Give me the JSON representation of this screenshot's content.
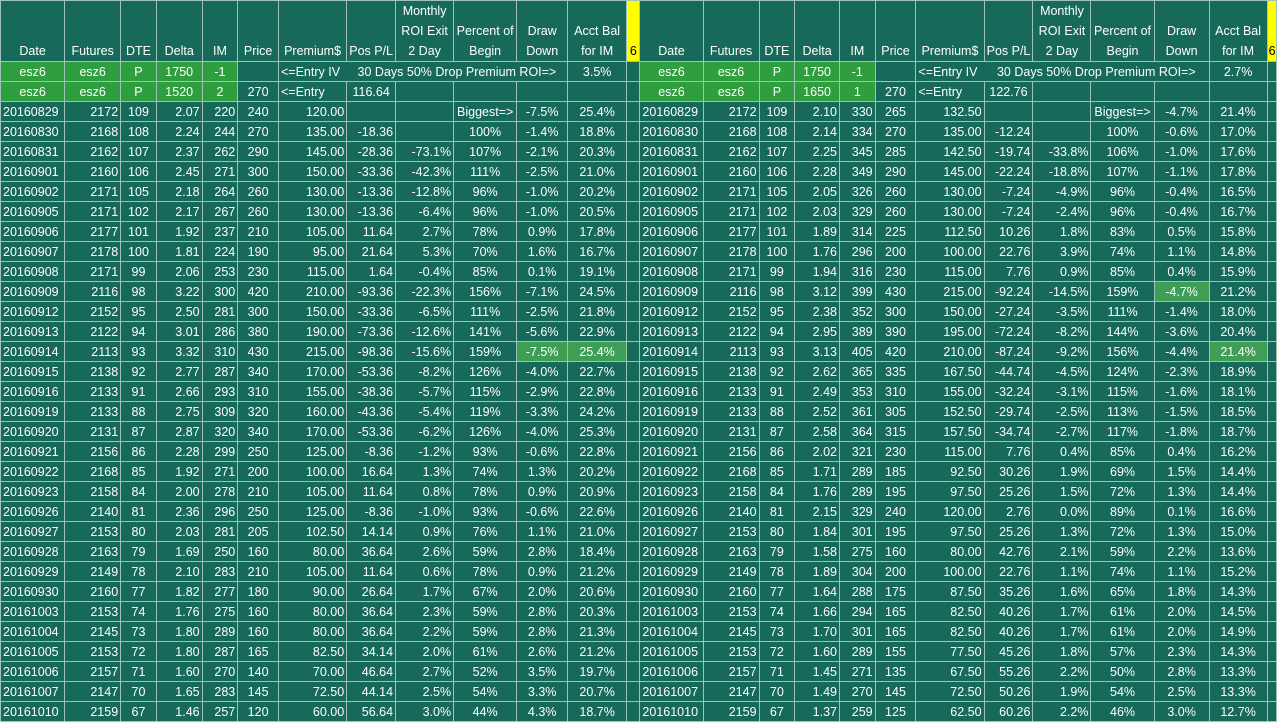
{
  "headers_left": [
    "Date",
    "Futures",
    "DTE",
    "Delta",
    "IM",
    "Price",
    "Premium$",
    "Pos P/L",
    "Monthly ROI Exit 2 Day",
    "Percent of Begin",
    "Draw Down",
    "Acct Bal for IM",
    "6"
  ],
  "headers_right": [
    "Date",
    "Futures",
    "DTE",
    "Delta",
    "IM",
    "Price",
    "Premium$",
    "Pos P/L",
    "Monthly ROI Exit 2 Day",
    "Percent of Begin",
    "Draw Down",
    "Acct Bal for IM",
    "6"
  ],
  "left": {
    "entry1": {
      "date": "esz6",
      "fut": "esz6",
      "type": "P",
      "strike": "1750",
      "qty": "-1",
      "note": "<=Entry IV",
      "note2": "30 Days 50% Drop Premium ROI=>",
      "roi": "3.5%"
    },
    "entry2": {
      "date": "esz6",
      "fut": "esz6",
      "type": "P",
      "strike": "1520",
      "qty": "2",
      "price": "270",
      "note": "<=Entry",
      "value": "116.64"
    },
    "biggest_label": "Biggest=>"
  },
  "right": {
    "entry1": {
      "date": "esz6",
      "fut": "esz6",
      "type": "P",
      "strike": "1750",
      "qty": "-1",
      "note": "<=Entry IV",
      "note2": "30 Days 50% Drop Premium ROI=>",
      "roi": "2.7%"
    },
    "entry2": {
      "date": "esz6",
      "fut": "esz6",
      "type": "P",
      "strike": "1650",
      "qty": "1",
      "price": "270",
      "note": "<=Entry",
      "value": "122.76"
    },
    "biggest_label": "Biggest=>"
  },
  "rows": [
    {
      "l": [
        "20160829",
        "2172",
        "109",
        "2.07",
        "220",
        "240",
        "120.00",
        "",
        "",
        "",
        "-7.5%",
        "25.4%"
      ],
      "r": [
        "20160829",
        "2172",
        "109",
        "2.10",
        "330",
        "265",
        "132.50",
        "",
        "",
        "",
        "-4.7%",
        "21.4%"
      ]
    },
    {
      "l": [
        "20160830",
        "2168",
        "108",
        "2.24",
        "244",
        "270",
        "135.00",
        "-18.36",
        "",
        "100%",
        "-1.4%",
        "18.8%"
      ],
      "r": [
        "20160830",
        "2168",
        "108",
        "2.14",
        "334",
        "270",
        "135.00",
        "-12.24",
        "",
        "100%",
        "-0.6%",
        "17.0%"
      ]
    },
    {
      "l": [
        "20160831",
        "2162",
        "107",
        "2.37",
        "262",
        "290",
        "145.00",
        "-28.36",
        "-73.1%",
        "107%",
        "-2.1%",
        "20.3%"
      ],
      "r": [
        "20160831",
        "2162",
        "107",
        "2.25",
        "345",
        "285",
        "142.50",
        "-19.74",
        "-33.8%",
        "106%",
        "-1.0%",
        "17.6%"
      ]
    },
    {
      "l": [
        "20160901",
        "2160",
        "106",
        "2.45",
        "271",
        "300",
        "150.00",
        "-33.36",
        "-42.3%",
        "111%",
        "-2.5%",
        "21.0%"
      ],
      "r": [
        "20160901",
        "2160",
        "106",
        "2.28",
        "349",
        "290",
        "145.00",
        "-22.24",
        "-18.8%",
        "107%",
        "-1.1%",
        "17.8%"
      ]
    },
    {
      "l": [
        "20160902",
        "2171",
        "105",
        "2.18",
        "264",
        "260",
        "130.00",
        "-13.36",
        "-12.8%",
        "96%",
        "-1.0%",
        "20.2%"
      ],
      "r": [
        "20160902",
        "2171",
        "105",
        "2.05",
        "326",
        "260",
        "130.00",
        "-7.24",
        "-4.9%",
        "96%",
        "-0.4%",
        "16.5%"
      ]
    },
    {
      "l": [
        "20160905",
        "2171",
        "102",
        "2.17",
        "267",
        "260",
        "130.00",
        "-13.36",
        "-6.4%",
        "96%",
        "-1.0%",
        "20.5%"
      ],
      "r": [
        "20160905",
        "2171",
        "102",
        "2.03",
        "329",
        "260",
        "130.00",
        "-7.24",
        "-2.4%",
        "96%",
        "-0.4%",
        "16.7%"
      ]
    },
    {
      "l": [
        "20160906",
        "2177",
        "101",
        "1.92",
        "237",
        "210",
        "105.00",
        "11.64",
        "2.7%",
        "78%",
        "0.9%",
        "17.8%"
      ],
      "r": [
        "20160906",
        "2177",
        "101",
        "1.89",
        "314",
        "225",
        "112.50",
        "10.26",
        "1.8%",
        "83%",
        "0.5%",
        "15.8%"
      ]
    },
    {
      "l": [
        "20160907",
        "2178",
        "100",
        "1.81",
        "224",
        "190",
        "95.00",
        "21.64",
        "5.3%",
        "70%",
        "1.6%",
        "16.7%"
      ],
      "r": [
        "20160907",
        "2178",
        "100",
        "1.76",
        "296",
        "200",
        "100.00",
        "22.76",
        "3.9%",
        "74%",
        "1.1%",
        "14.8%"
      ]
    },
    {
      "l": [
        "20160908",
        "2171",
        "99",
        "2.06",
        "253",
        "230",
        "115.00",
        "1.64",
        "-0.4%",
        "85%",
        "0.1%",
        "19.1%"
      ],
      "r": [
        "20160908",
        "2171",
        "99",
        "1.94",
        "316",
        "230",
        "115.00",
        "7.76",
        "0.9%",
        "85%",
        "0.4%",
        "15.9%"
      ]
    },
    {
      "l": [
        "20160909",
        "2116",
        "98",
        "3.22",
        "300",
        "420",
        "210.00",
        "-93.36",
        "-22.3%",
        "156%",
        "-7.1%",
        "24.5%"
      ],
      "r": [
        "20160909",
        "2116",
        "98",
        "3.12",
        "399",
        "430",
        "215.00",
        "-92.24",
        "-14.5%",
        "159%",
        "-4.7%",
        "21.2%"
      ]
    },
    {
      "l": [
        "20160912",
        "2152",
        "95",
        "2.50",
        "281",
        "300",
        "150.00",
        "-33.36",
        "-6.5%",
        "111%",
        "-2.5%",
        "21.8%"
      ],
      "r": [
        "20160912",
        "2152",
        "95",
        "2.38",
        "352",
        "300",
        "150.00",
        "-27.24",
        "-3.5%",
        "111%",
        "-1.4%",
        "18.0%"
      ]
    },
    {
      "l": [
        "20160913",
        "2122",
        "94",
        "3.01",
        "286",
        "380",
        "190.00",
        "-73.36",
        "-12.6%",
        "141%",
        "-5.6%",
        "22.9%"
      ],
      "r": [
        "20160913",
        "2122",
        "94",
        "2.95",
        "389",
        "390",
        "195.00",
        "-72.24",
        "-8.2%",
        "144%",
        "-3.6%",
        "20.4%"
      ]
    },
    {
      "l": [
        "20160914",
        "2113",
        "93",
        "3.32",
        "310",
        "430",
        "215.00",
        "-98.36",
        "-15.6%",
        "159%",
        "-7.5%",
        "25.4%"
      ],
      "r": [
        "20160914",
        "2113",
        "93",
        "3.13",
        "405",
        "420",
        "210.00",
        "-87.24",
        "-9.2%",
        "156%",
        "-4.4%",
        "21.4%"
      ]
    },
    {
      "l": [
        "20160915",
        "2138",
        "92",
        "2.77",
        "287",
        "340",
        "170.00",
        "-53.36",
        "-8.2%",
        "126%",
        "-4.0%",
        "22.7%"
      ],
      "r": [
        "20160915",
        "2138",
        "92",
        "2.62",
        "365",
        "335",
        "167.50",
        "-44.74",
        "-4.5%",
        "124%",
        "-2.3%",
        "18.9%"
      ]
    },
    {
      "l": [
        "20160916",
        "2133",
        "91",
        "2.66",
        "293",
        "310",
        "155.00",
        "-38.36",
        "-5.7%",
        "115%",
        "-2.9%",
        "22.8%"
      ],
      "r": [
        "20160916",
        "2133",
        "91",
        "2.49",
        "353",
        "310",
        "155.00",
        "-32.24",
        "-3.1%",
        "115%",
        "-1.6%",
        "18.1%"
      ]
    },
    {
      "l": [
        "20160919",
        "2133",
        "88",
        "2.75",
        "309",
        "320",
        "160.00",
        "-43.36",
        "-5.4%",
        "119%",
        "-3.3%",
        "24.2%"
      ],
      "r": [
        "20160919",
        "2133",
        "88",
        "2.52",
        "361",
        "305",
        "152.50",
        "-29.74",
        "-2.5%",
        "113%",
        "-1.5%",
        "18.5%"
      ]
    },
    {
      "l": [
        "20160920",
        "2131",
        "87",
        "2.87",
        "320",
        "340",
        "170.00",
        "-53.36",
        "-6.2%",
        "126%",
        "-4.0%",
        "25.3%"
      ],
      "r": [
        "20160920",
        "2131",
        "87",
        "2.58",
        "364",
        "315",
        "157.50",
        "-34.74",
        "-2.7%",
        "117%",
        "-1.8%",
        "18.7%"
      ]
    },
    {
      "l": [
        "20160921",
        "2156",
        "86",
        "2.28",
        "299",
        "250",
        "125.00",
        "-8.36",
        "-1.2%",
        "93%",
        "-0.6%",
        "22.8%"
      ],
      "r": [
        "20160921",
        "2156",
        "86",
        "2.02",
        "321",
        "230",
        "115.00",
        "7.76",
        "0.4%",
        "85%",
        "0.4%",
        "16.2%"
      ]
    },
    {
      "l": [
        "20160922",
        "2168",
        "85",
        "1.92",
        "271",
        "200",
        "100.00",
        "16.64",
        "1.3%",
        "74%",
        "1.3%",
        "20.2%"
      ],
      "r": [
        "20160922",
        "2168",
        "85",
        "1.71",
        "289",
        "185",
        "92.50",
        "30.26",
        "1.9%",
        "69%",
        "1.5%",
        "14.4%"
      ]
    },
    {
      "l": [
        "20160923",
        "2158",
        "84",
        "2.00",
        "278",
        "210",
        "105.00",
        "11.64",
        "0.8%",
        "78%",
        "0.9%",
        "20.9%"
      ],
      "r": [
        "20160923",
        "2158",
        "84",
        "1.76",
        "289",
        "195",
        "97.50",
        "25.26",
        "1.5%",
        "72%",
        "1.3%",
        "14.4%"
      ]
    },
    {
      "l": [
        "20160926",
        "2140",
        "81",
        "2.36",
        "296",
        "250",
        "125.00",
        "-8.36",
        "-1.0%",
        "93%",
        "-0.6%",
        "22.6%"
      ],
      "r": [
        "20160926",
        "2140",
        "81",
        "2.15",
        "329",
        "240",
        "120.00",
        "2.76",
        "0.0%",
        "89%",
        "0.1%",
        "16.6%"
      ]
    },
    {
      "l": [
        "20160927",
        "2153",
        "80",
        "2.03",
        "281",
        "205",
        "102.50",
        "14.14",
        "0.9%",
        "76%",
        "1.1%",
        "21.0%"
      ],
      "r": [
        "20160927",
        "2153",
        "80",
        "1.84",
        "301",
        "195",
        "97.50",
        "25.26",
        "1.3%",
        "72%",
        "1.3%",
        "15.0%"
      ]
    },
    {
      "l": [
        "20160928",
        "2163",
        "79",
        "1.69",
        "250",
        "160",
        "80.00",
        "36.64",
        "2.6%",
        "59%",
        "2.8%",
        "18.4%"
      ],
      "r": [
        "20160928",
        "2163",
        "79",
        "1.58",
        "275",
        "160",
        "80.00",
        "42.76",
        "2.1%",
        "59%",
        "2.2%",
        "13.6%"
      ]
    },
    {
      "l": [
        "20160929",
        "2149",
        "78",
        "2.10",
        "283",
        "210",
        "105.00",
        "11.64",
        "0.6%",
        "78%",
        "0.9%",
        "21.2%"
      ],
      "r": [
        "20160929",
        "2149",
        "78",
        "1.89",
        "304",
        "200",
        "100.00",
        "22.76",
        "1.1%",
        "74%",
        "1.1%",
        "15.2%"
      ]
    },
    {
      "l": [
        "20160930",
        "2160",
        "77",
        "1.82",
        "277",
        "180",
        "90.00",
        "26.64",
        "1.7%",
        "67%",
        "2.0%",
        "20.6%"
      ],
      "r": [
        "20160930",
        "2160",
        "77",
        "1.64",
        "288",
        "175",
        "87.50",
        "35.26",
        "1.6%",
        "65%",
        "1.8%",
        "14.3%"
      ]
    },
    {
      "l": [
        "20161003",
        "2153",
        "74",
        "1.76",
        "275",
        "160",
        "80.00",
        "36.64",
        "2.3%",
        "59%",
        "2.8%",
        "20.3%"
      ],
      "r": [
        "20161003",
        "2153",
        "74",
        "1.66",
        "294",
        "165",
        "82.50",
        "40.26",
        "1.7%",
        "61%",
        "2.0%",
        "14.5%"
      ]
    },
    {
      "l": [
        "20161004",
        "2145",
        "73",
        "1.80",
        "289",
        "160",
        "80.00",
        "36.64",
        "2.2%",
        "59%",
        "2.8%",
        "21.3%"
      ],
      "r": [
        "20161004",
        "2145",
        "73",
        "1.70",
        "301",
        "165",
        "82.50",
        "40.26",
        "1.7%",
        "61%",
        "2.0%",
        "14.9%"
      ]
    },
    {
      "l": [
        "20161005",
        "2153",
        "72",
        "1.80",
        "287",
        "165",
        "82.50",
        "34.14",
        "2.0%",
        "61%",
        "2.6%",
        "21.2%"
      ],
      "r": [
        "20161005",
        "2153",
        "72",
        "1.60",
        "289",
        "155",
        "77.50",
        "45.26",
        "1.8%",
        "57%",
        "2.3%",
        "14.3%"
      ]
    },
    {
      "l": [
        "20161006",
        "2157",
        "71",
        "1.60",
        "270",
        "140",
        "70.00",
        "46.64",
        "2.7%",
        "52%",
        "3.5%",
        "19.7%"
      ],
      "r": [
        "20161006",
        "2157",
        "71",
        "1.45",
        "271",
        "135",
        "67.50",
        "55.26",
        "2.2%",
        "50%",
        "2.8%",
        "13.3%"
      ]
    },
    {
      "l": [
        "20161007",
        "2147",
        "70",
        "1.65",
        "283",
        "145",
        "72.50",
        "44.14",
        "2.5%",
        "54%",
        "3.3%",
        "20.7%"
      ],
      "r": [
        "20161007",
        "2147",
        "70",
        "1.49",
        "270",
        "145",
        "72.50",
        "50.26",
        "1.9%",
        "54%",
        "2.5%",
        "13.3%"
      ]
    },
    {
      "l": [
        "20161010",
        "2159",
        "67",
        "1.46",
        "257",
        "120",
        "60.00",
        "56.64",
        "3.0%",
        "44%",
        "4.3%",
        "18.7%"
      ],
      "r": [
        "20161010",
        "2159",
        "67",
        "1.37",
        "259",
        "125",
        "62.50",
        "60.26",
        "2.2%",
        "46%",
        "3.0%",
        "12.7%"
      ]
    }
  ]
}
